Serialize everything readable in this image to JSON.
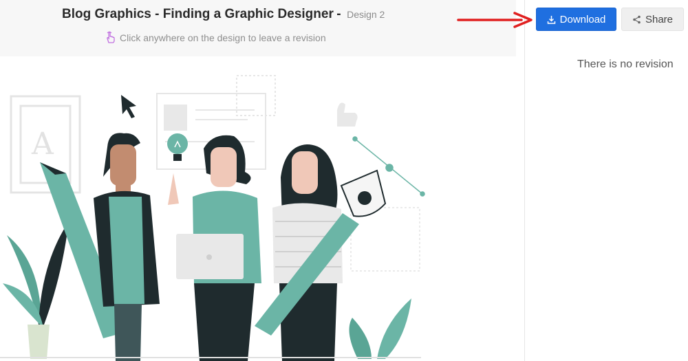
{
  "header": {
    "title": "Blog Graphics - Finding a Graphic Designer",
    "separator": "-",
    "design_label": "Design 2",
    "hint": "Click anywhere on the design to leave a revision",
    "hint_icon": "hand-pointer-icon"
  },
  "toolbar": {
    "download_label": "Download",
    "download_icon": "download-icon",
    "share_label": "Share",
    "share_icon": "share-icon",
    "accent_color": "#1f6fe0",
    "annotation_arrow_color": "#e02020"
  },
  "revisions": {
    "empty_text": "There is no revision"
  },
  "illustration": {
    "letter_tile": "A",
    "primary_color": "#6bb5a6",
    "dark_color": "#1f2b2e"
  }
}
